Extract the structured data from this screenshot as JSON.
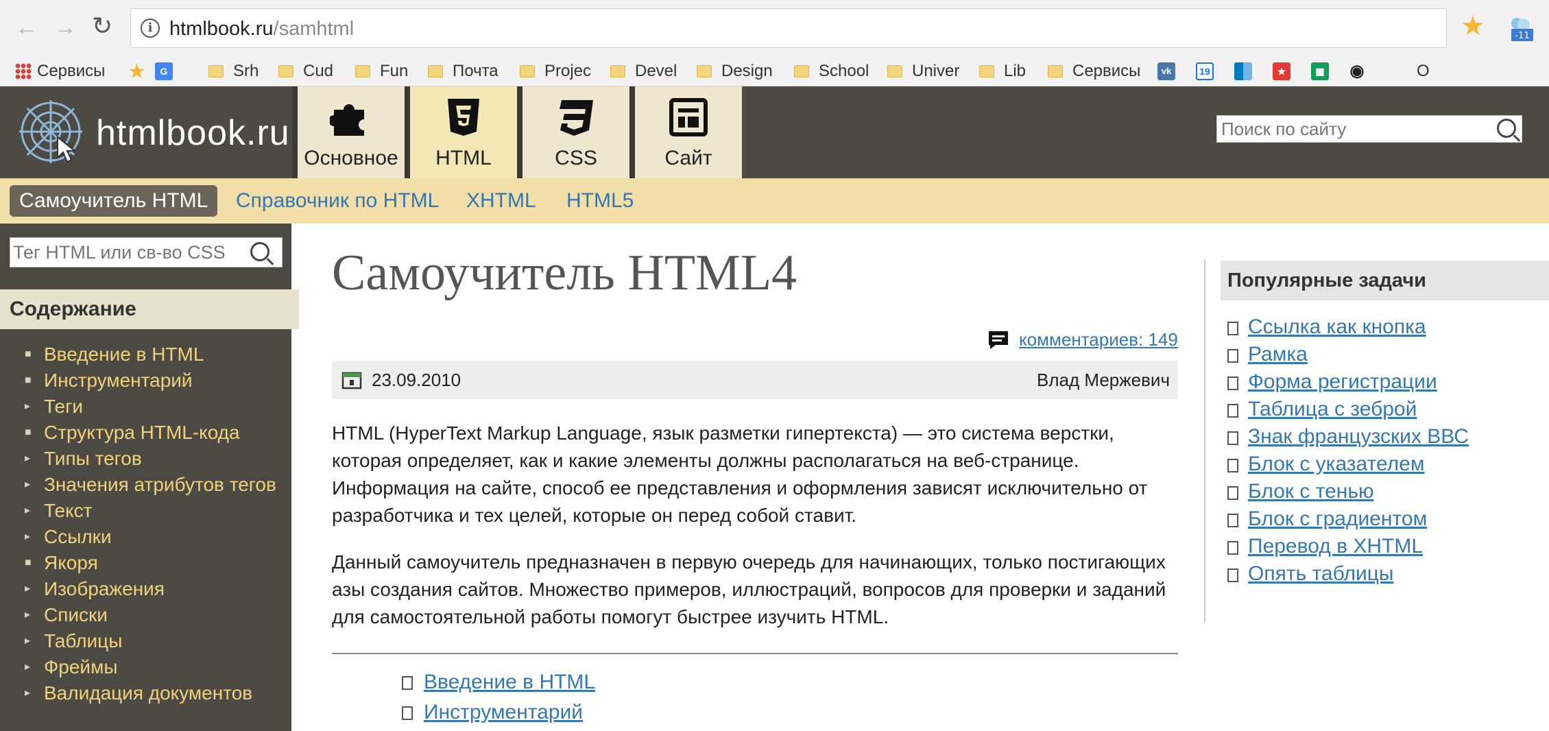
{
  "browser": {
    "url_host": "htmlbook.ru",
    "url_path": "/samhtml",
    "ext_badge": "-11",
    "bookmarks": [
      {
        "label": "Сервисы",
        "type": "apps"
      },
      {
        "label": "",
        "type": "star"
      },
      {
        "label": "",
        "type": "translate"
      },
      {
        "label": "Srh",
        "type": "folder"
      },
      {
        "label": "Cud",
        "type": "folder"
      },
      {
        "label": "Fun",
        "type": "folder"
      },
      {
        "label": "Почта",
        "type": "folder"
      },
      {
        "label": "Projec",
        "type": "folder"
      },
      {
        "label": "Devel",
        "type": "folder"
      },
      {
        "label": "Design",
        "type": "folder"
      },
      {
        "label": "School",
        "type": "folder"
      },
      {
        "label": "Univer",
        "type": "folder"
      },
      {
        "label": "Lib",
        "type": "folder"
      },
      {
        "label": "Сервисы",
        "type": "folder"
      }
    ],
    "bookmark_icons": [
      "vk-icon",
      "calendar-19-icon",
      "trello-icon",
      "bookmark-red-icon",
      "sheets-icon",
      "github-icon"
    ],
    "calendar_day": "19",
    "vk_text": "vk",
    "trailing_text": "О"
  },
  "site": {
    "logo_text": "htmlbook.ru",
    "tabs": [
      {
        "label": "Основное",
        "icon": "puzzle-icon"
      },
      {
        "label": "HTML",
        "icon": "html5-icon"
      },
      {
        "label": "CSS",
        "icon": "css3-icon"
      },
      {
        "label": "Сайт",
        "icon": "layout-icon"
      }
    ],
    "search_placeholder": "Поиск по сайту"
  },
  "subnav": {
    "active": "Самоучитель HTML",
    "links": [
      "Справочник по HTML",
      "XHTML",
      "HTML5"
    ]
  },
  "sidebar": {
    "search_placeholder": "Тег HTML или св-во CSS",
    "heading": "Содержание",
    "items": [
      {
        "label": "Введение в HTML",
        "bullet": "■"
      },
      {
        "label": "Инструментарий",
        "bullet": "■"
      },
      {
        "label": "Теги",
        "bullet": "▸"
      },
      {
        "label": "Структура HTML-кода",
        "bullet": "■"
      },
      {
        "label": "Типы тегов",
        "bullet": "▸"
      },
      {
        "label": "Значения атрибутов тегов",
        "bullet": "▸"
      },
      {
        "label": "Текст",
        "bullet": "▸"
      },
      {
        "label": "Ссылки",
        "bullet": "▸"
      },
      {
        "label": "Якоря",
        "bullet": "■"
      },
      {
        "label": "Изображения",
        "bullet": "▸"
      },
      {
        "label": "Списки",
        "bullet": "▸"
      },
      {
        "label": "Таблицы",
        "bullet": "▸"
      },
      {
        "label": "Фреймы",
        "bullet": "▸"
      },
      {
        "label": "Валидация документов",
        "bullet": "▸"
      }
    ]
  },
  "main": {
    "title": "Самоучитель HTML4",
    "comments": "комментариев: 149",
    "date": "23.09.2010",
    "author": "Влад Мержевич",
    "para1": "HTML (HyperText Markup Language, язык разметки гипертекста) — это система верстки, которая определяет, как и какие элементы должны располагаться на веб-странице. Информация на сайте, способ ее представления и оформления зависят исключительно от разработчика и тех целей, которые он перед собой ставит.",
    "para2": "Данный самоучитель предназначен в первую очередь для начинающих, только постигающих азы создания сайтов. Множество примеров, иллюстраций, вопросов для проверки и заданий для самостоятельной работы помогут быстрее изучить HTML.",
    "toc_links": [
      "Введение в HTML",
      "Инструментарий"
    ]
  },
  "popular": {
    "heading": "Популярные задачи",
    "items": [
      "Ссылка как кнопка",
      "Рамка",
      "Форма регистрации",
      "Таблица с зеброй",
      "Знак французских ВВС",
      "Блок с указателем",
      "Блок с тенью",
      "Блок с градиентом",
      "Перевод в XHTML",
      "Опять таблицы"
    ]
  }
}
